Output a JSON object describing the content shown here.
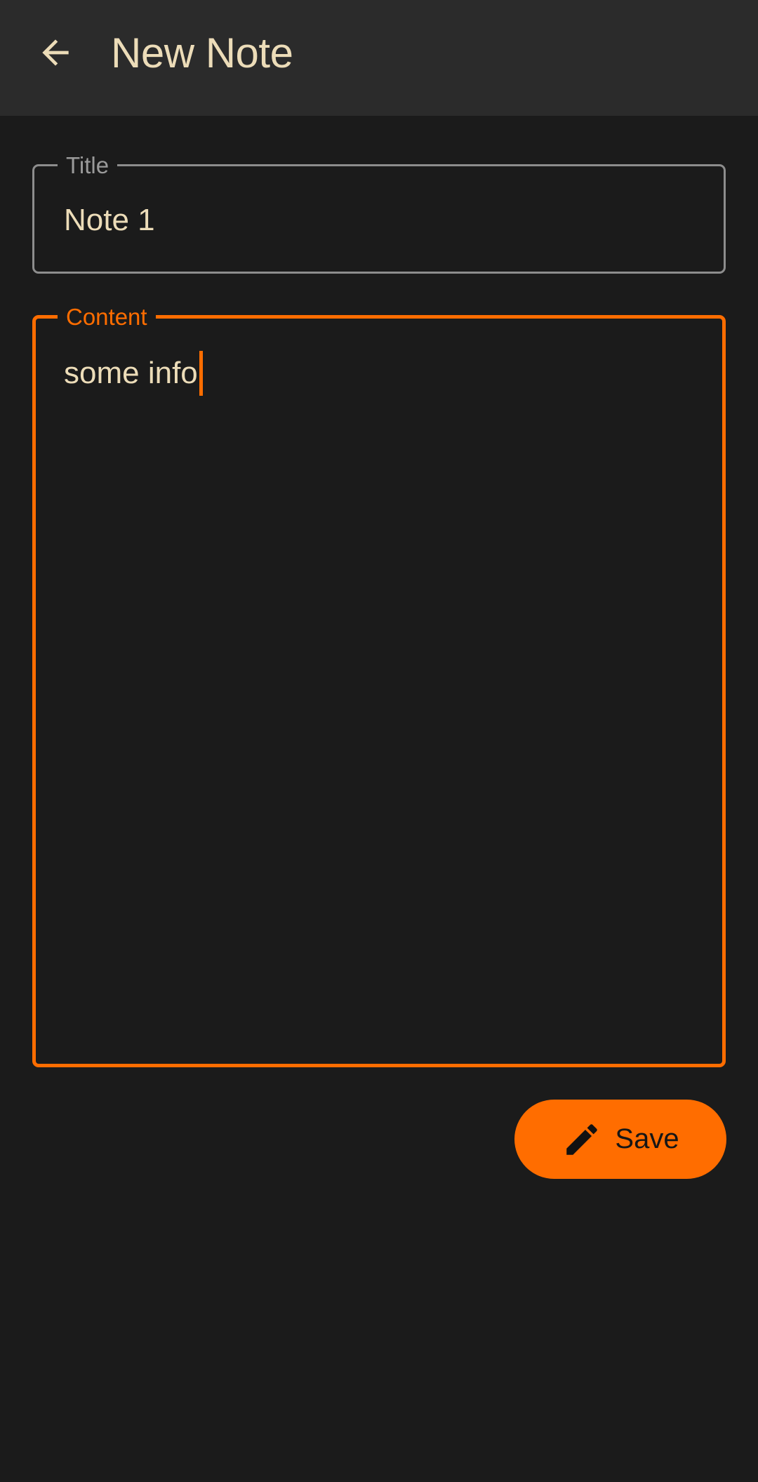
{
  "app_bar": {
    "title": "New Note",
    "back_icon": "arrow-back-icon"
  },
  "form": {
    "title_field": {
      "label": "Title",
      "value": "Note 1"
    },
    "content_field": {
      "label": "Content",
      "value": "some info",
      "focused": true
    }
  },
  "save_button": {
    "label": "Save",
    "icon": "pencil-icon"
  },
  "colors": {
    "accent": "#ff6d00",
    "background": "#1b1b1b",
    "app_bar": "#2b2b2b",
    "text": "#ecdcb8",
    "outline": "#8d8d8d"
  }
}
